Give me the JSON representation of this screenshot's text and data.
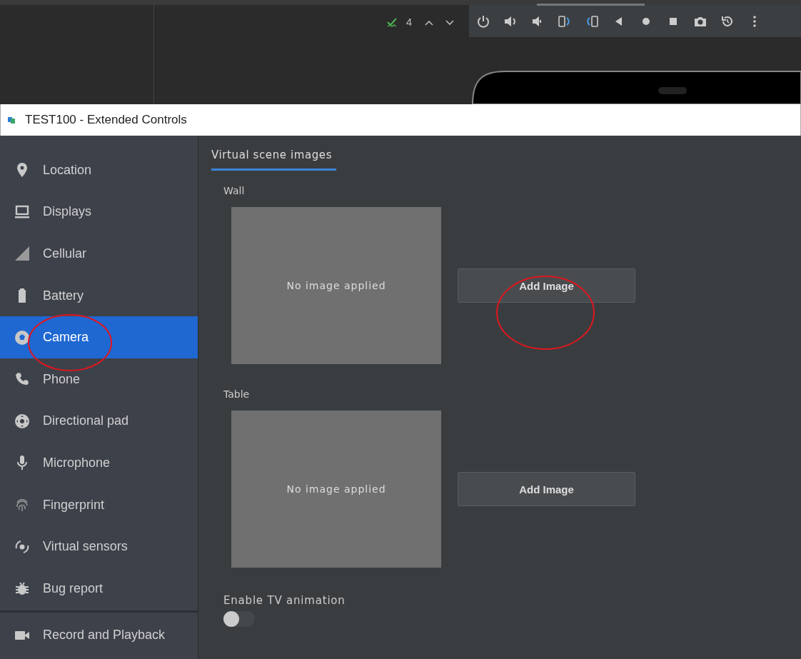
{
  "ide_toolbar": {
    "problem_count": "4"
  },
  "window": {
    "title": "TEST100 - Extended Controls"
  },
  "sidebar": {
    "items": [
      {
        "label": "Location",
        "selected": false
      },
      {
        "label": "Displays",
        "selected": false
      },
      {
        "label": "Cellular",
        "selected": false
      },
      {
        "label": "Battery",
        "selected": false
      },
      {
        "label": "Camera",
        "selected": true
      },
      {
        "label": "Phone",
        "selected": false
      },
      {
        "label": "Directional pad",
        "selected": false
      },
      {
        "label": "Microphone",
        "selected": false
      },
      {
        "label": "Fingerprint",
        "selected": false
      },
      {
        "label": "Virtual sensors",
        "selected": false
      },
      {
        "label": "Bug report",
        "selected": false
      }
    ],
    "footer_item": {
      "label": "Record and Playback",
      "selected": false
    }
  },
  "tabs": [
    {
      "label": "Virtual scene images",
      "selected": true
    }
  ],
  "scenes": [
    {
      "label": "Wall",
      "preview_text": "No image applied",
      "button": "Add Image"
    },
    {
      "label": "Table",
      "preview_text": "No image applied",
      "button": "Add Image"
    }
  ],
  "tv_animation": {
    "label": "Enable TV animation",
    "on": false
  }
}
